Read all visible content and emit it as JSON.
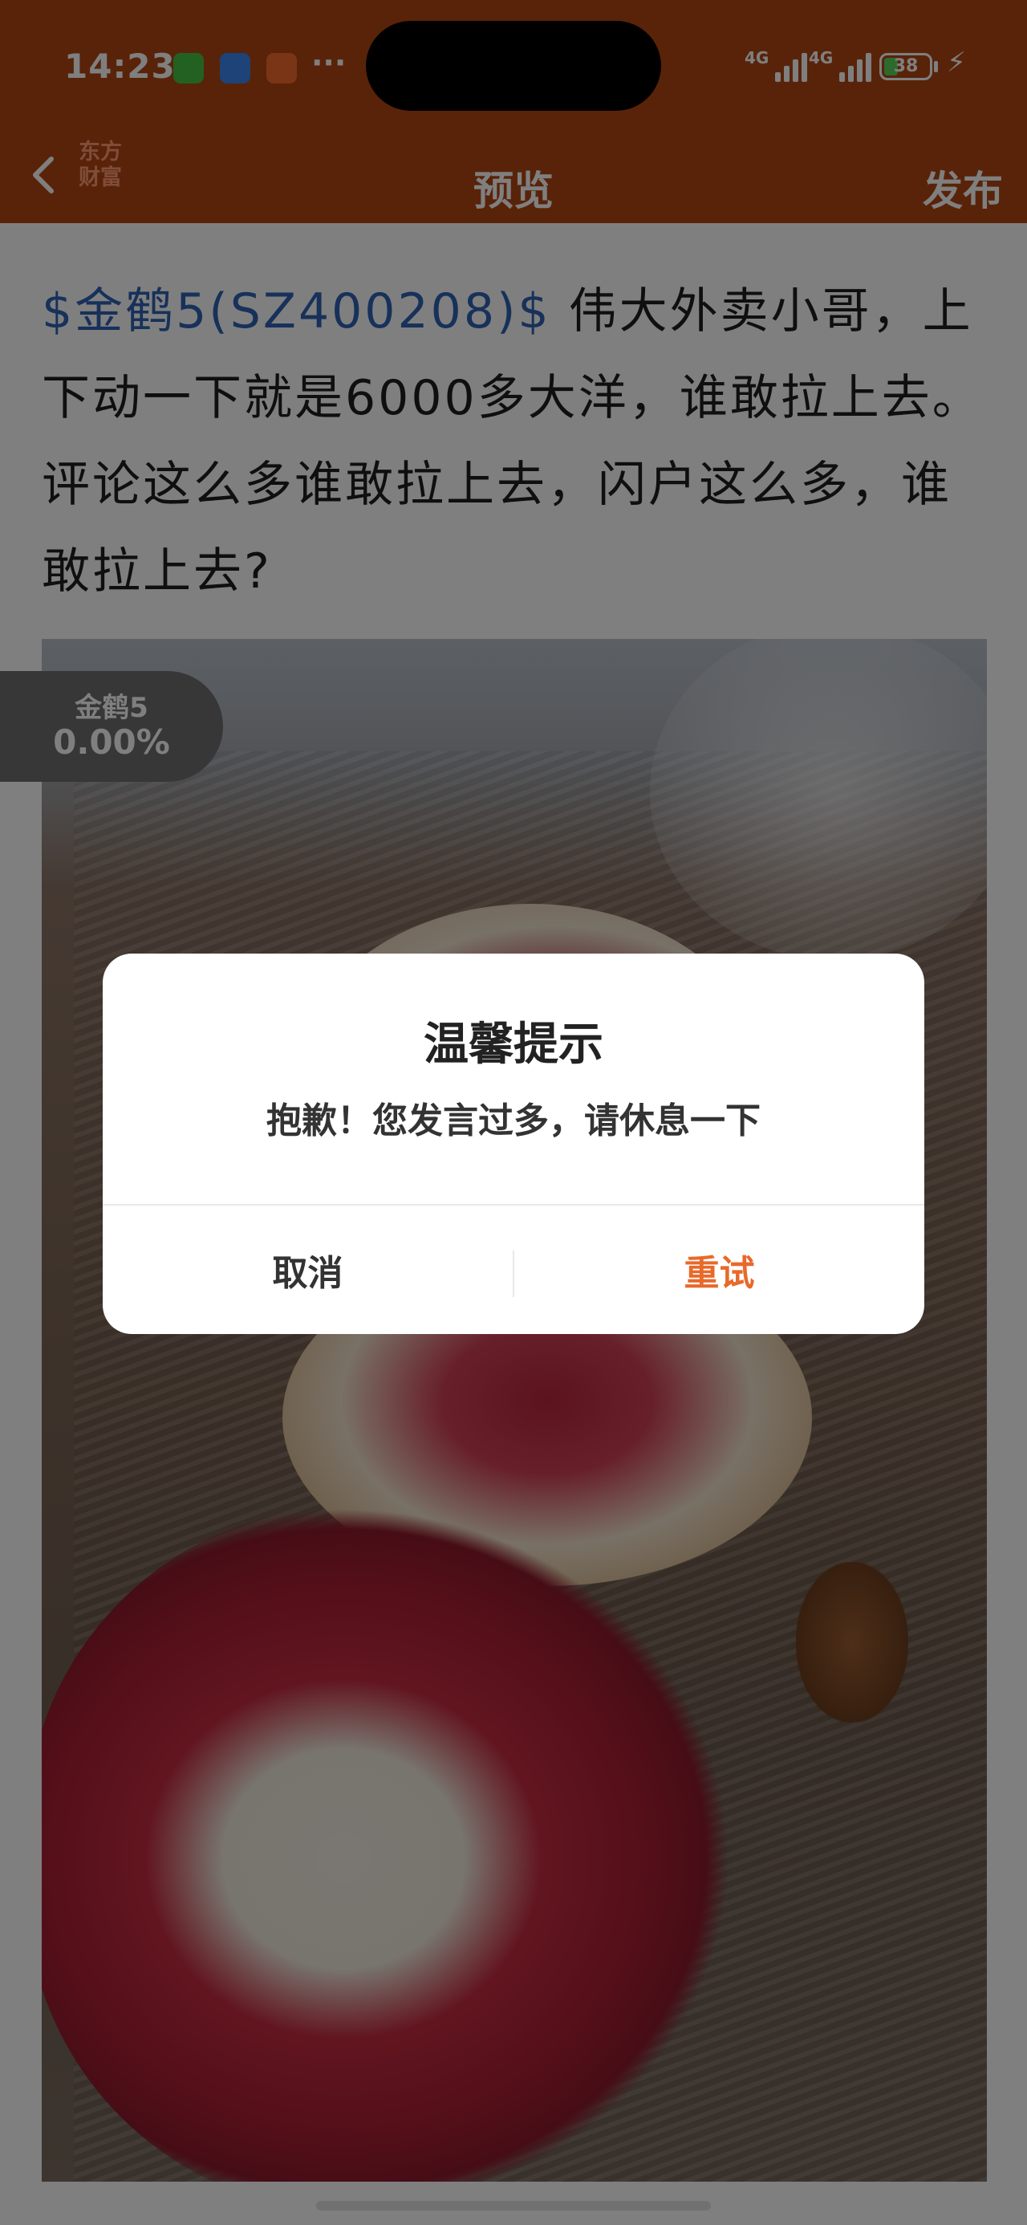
{
  "status_bar": {
    "time": "14:23",
    "more": "···",
    "network_1": "4G",
    "network_2": "4G",
    "battery_level": "38",
    "battery_fraction": 0.38,
    "icons": [
      "app-icon-green",
      "browser-icon",
      "video-app-icon",
      "signal-icon",
      "battery-icon",
      "charging-bolt-icon"
    ]
  },
  "nav": {
    "brand": "东方\n财富",
    "title": "预览",
    "publish": "发布",
    "back_icon": "chevron-left-icon"
  },
  "post": {
    "stock_tag": "$金鹤5(SZ400208)$",
    "body": " 伟大外卖小哥，上下动一下就是6000多大洋，谁敢拉上去。评论这么多谁敢拉上去，闪户这么多，谁敢拉上去?"
  },
  "stock_badge": {
    "name": "金鹤5",
    "change": "0.00%"
  },
  "dialog": {
    "title": "温馨提示",
    "message": "抱歉！您发言过多，请休息一下",
    "cancel": "取消",
    "retry": "重试"
  },
  "colors": {
    "brand_header": "#b34713",
    "stock_link": "#2e63b5",
    "retry_accent": "#e8692a"
  }
}
